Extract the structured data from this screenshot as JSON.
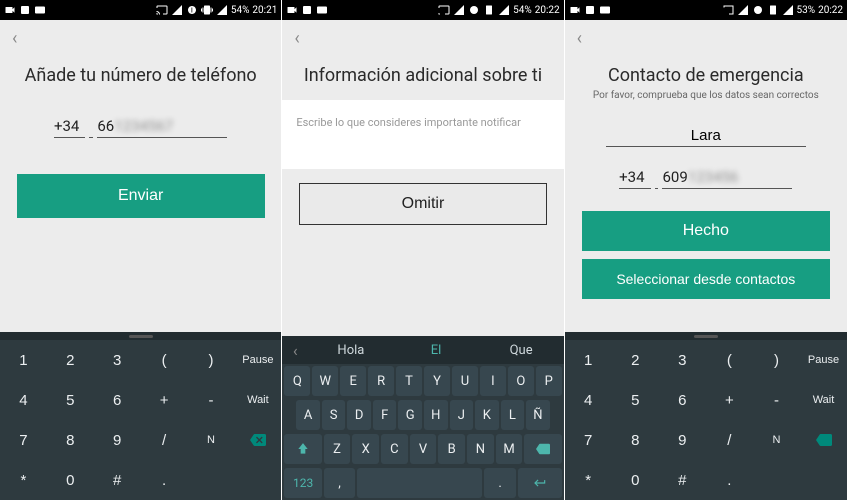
{
  "statusbar": {
    "s1": {
      "battery": "54%",
      "time": "20:21"
    },
    "s2": {
      "battery": "54%",
      "time": "20:22"
    },
    "s3": {
      "battery": "53%",
      "time": "20:22"
    }
  },
  "screen1": {
    "title": "Añade tu número de teléfono",
    "prefix": "+34",
    "phone": "66",
    "submit": "Enviar"
  },
  "screen2": {
    "title": "Información adicional sobre ti",
    "placeholder": "Escribe lo que consideres importante notificar",
    "skip": "Omitir",
    "suggestions": [
      "Hola",
      "El",
      "Que"
    ]
  },
  "screen3": {
    "title": "Contacto de emergencia",
    "subtitle": "Por favor, comprueba que los datos sean correctos",
    "name": "Lara",
    "prefix": "+34",
    "phone": "609",
    "done": "Hecho",
    "select_contacts": "Seleccionar desde contactos"
  },
  "keypad": {
    "pause": "Pause",
    "wait": "Wait",
    "rows": [
      [
        "1",
        "2",
        "3",
        "(",
        ")"
      ],
      [
        "4",
        "5",
        "6",
        "+",
        "-"
      ],
      [
        "7",
        "8",
        "9",
        "/",
        "N"
      ],
      [
        "*",
        "0",
        "#",
        "."
      ]
    ]
  },
  "qwerty": {
    "r1": [
      "Q",
      "W",
      "E",
      "R",
      "T",
      "Y",
      "U",
      "I",
      "O",
      "P"
    ],
    "r2": [
      "A",
      "S",
      "D",
      "F",
      "G",
      "H",
      "J",
      "K",
      "L",
      "Ñ"
    ],
    "r3": [
      "Z",
      "X",
      "C",
      "V",
      "B",
      "N",
      "M"
    ],
    "num_label": "123"
  }
}
